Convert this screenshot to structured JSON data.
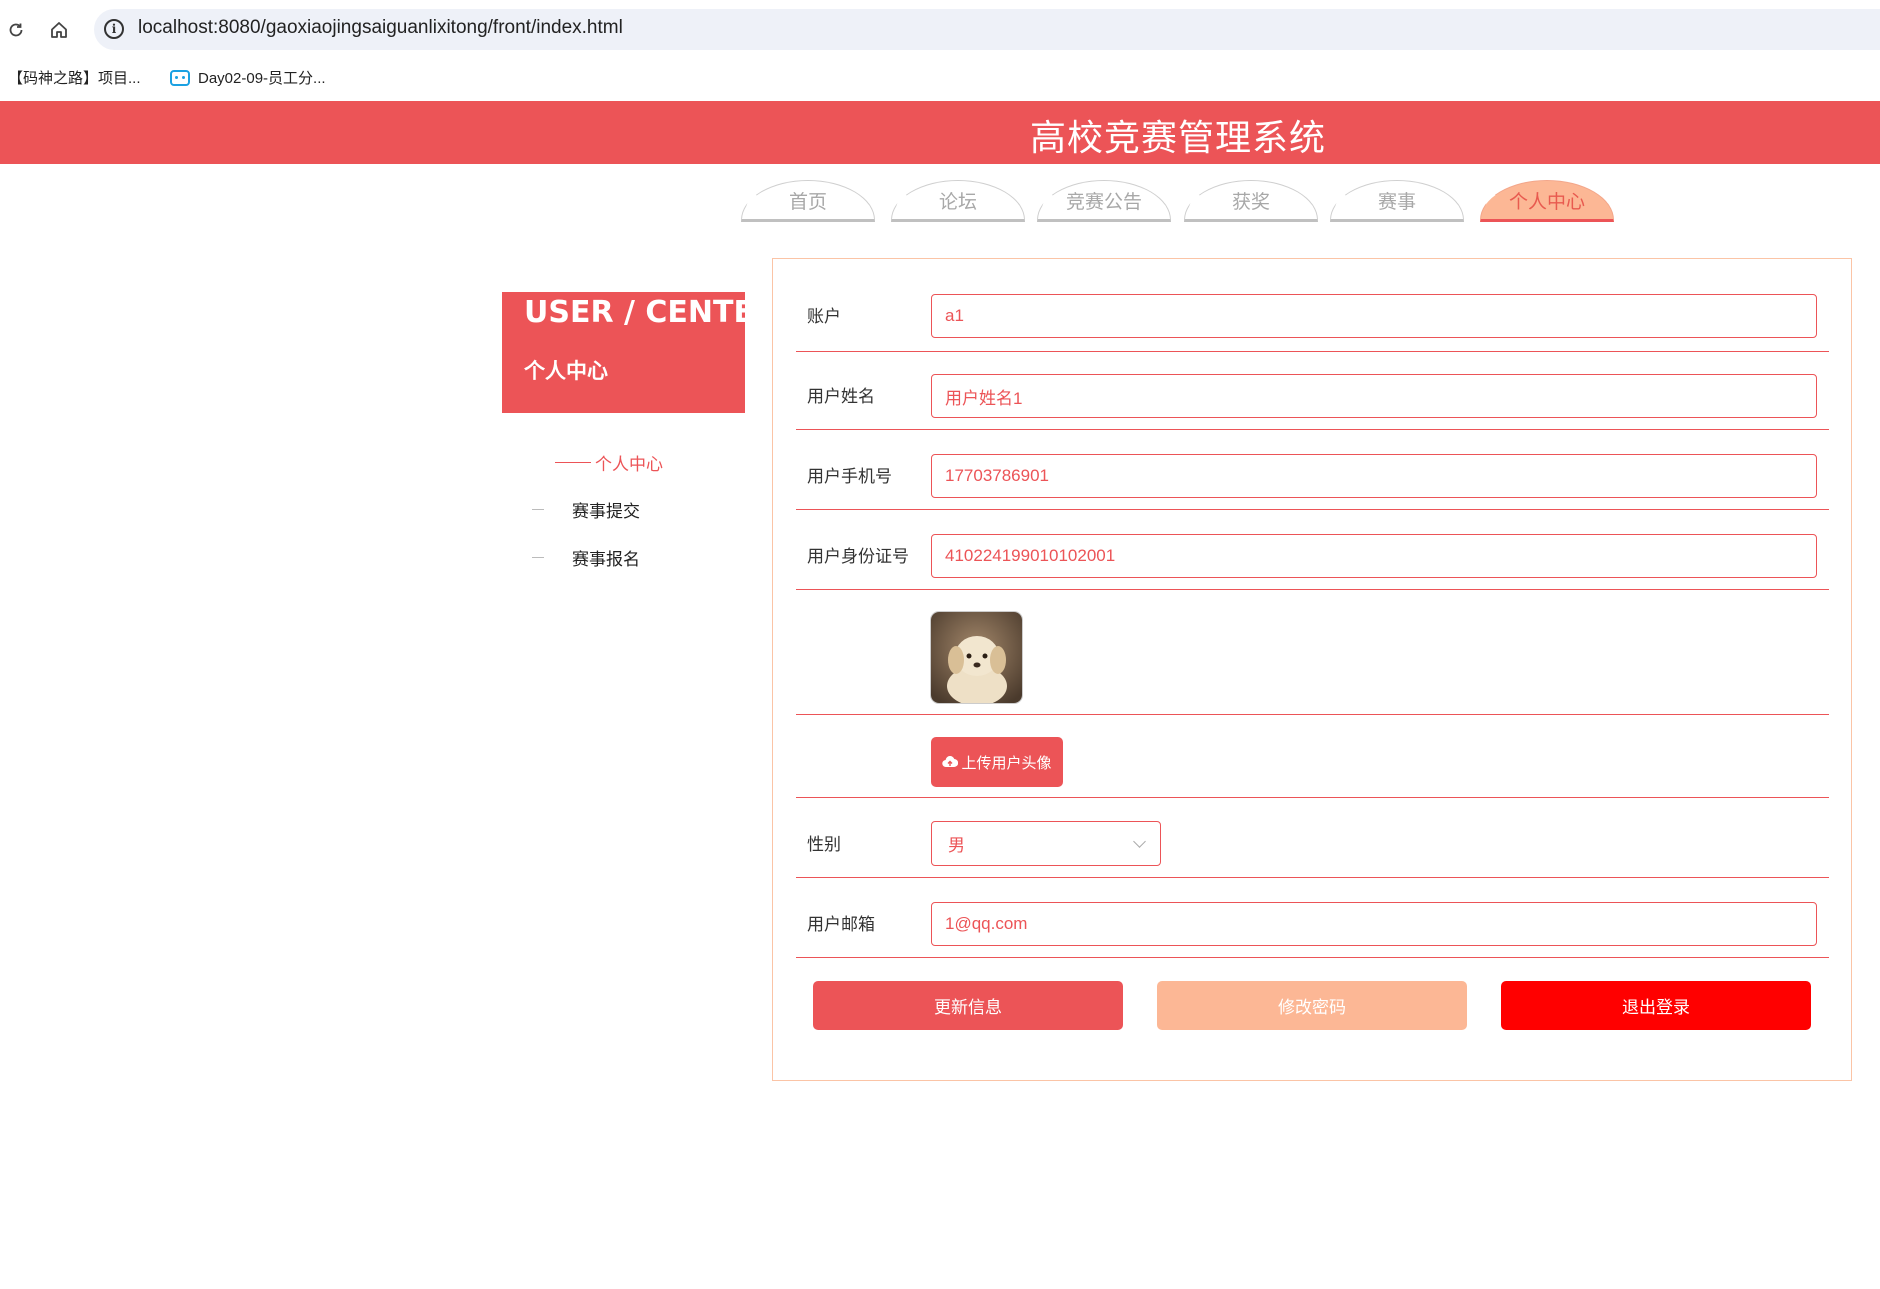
{
  "browser": {
    "url": "localhost:8080/gaoxiaojingsaiguanlixitong/front/index.html",
    "bookmarks": [
      {
        "label": "【码神之路】项目..."
      },
      {
        "label": "Day02-09-员工分..."
      }
    ]
  },
  "header": {
    "title": "高校竞赛管理系统"
  },
  "nav": {
    "tabs": [
      {
        "label": "首页"
      },
      {
        "label": "论坛"
      },
      {
        "label": "竞赛公告"
      },
      {
        "label": "获奖"
      },
      {
        "label": "赛事"
      },
      {
        "label": "个人中心",
        "active": true
      }
    ]
  },
  "sidebar": {
    "title_en": "USER / CENTER",
    "title_cn": "个人中心",
    "items": [
      {
        "label": "个人中心",
        "active": true
      },
      {
        "label": "赛事提交"
      },
      {
        "label": "赛事报名"
      }
    ]
  },
  "form": {
    "account": {
      "label": "账户",
      "value": "a1"
    },
    "name": {
      "label": "用户姓名",
      "value": "用户姓名1"
    },
    "phone": {
      "label": "用户手机号",
      "value": "17703786901"
    },
    "id_card": {
      "label": "用户身份证号",
      "value": "410224199010102001"
    },
    "upload_label": "上传用户头像",
    "gender": {
      "label": "性别",
      "value": "男"
    },
    "email": {
      "label": "用户邮箱",
      "value": "1@qq.com"
    }
  },
  "actions": {
    "update": "更新信息",
    "change_password": "修改密码",
    "logout": "退出登录"
  },
  "colors": {
    "primary": "#ec5457",
    "secondary": "#fcb795",
    "danger": "#ff0000"
  }
}
